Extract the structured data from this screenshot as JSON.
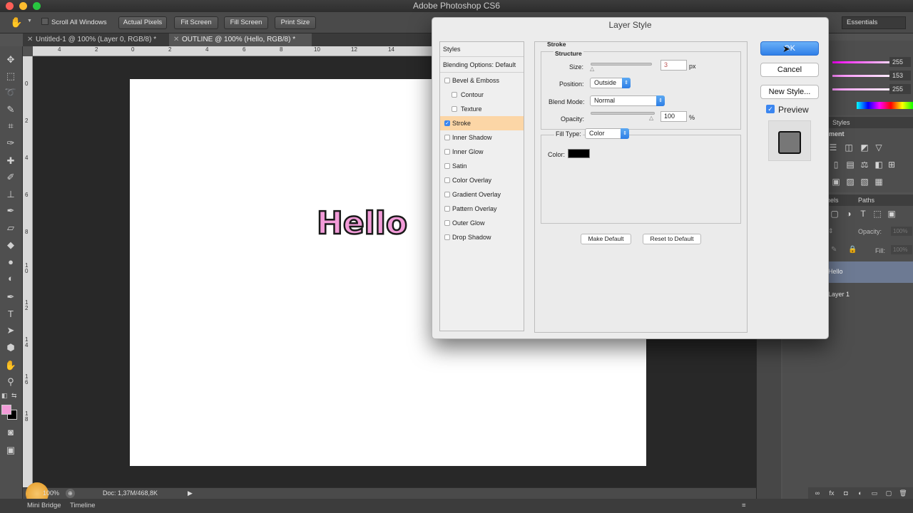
{
  "app": {
    "title": "Adobe Photoshop CS6"
  },
  "options_bar": {
    "scroll_all_windows": "Scroll All Windows",
    "actual_pixels": "Actual Pixels",
    "fit_screen": "Fit Screen",
    "fill_screen": "Fill Screen",
    "print_size": "Print Size",
    "workspace": "Essentials"
  },
  "tabs": [
    {
      "label": "Untitled-1 @ 100% (Layer 0, RGB/8) *"
    },
    {
      "label": "OUTLINE @ 100% (Hello, RGB/8) *"
    }
  ],
  "ruler": {
    "h_ticks": [
      "4",
      "2",
      "0",
      "2",
      "4",
      "6",
      "8",
      "10",
      "12",
      "14"
    ],
    "v_ticks": [
      "0",
      "2",
      "4",
      "6",
      "8",
      "1 0",
      "1 2",
      "1 4",
      "1 6",
      "1 8"
    ]
  },
  "canvas": {
    "text": "Hello",
    "text_fill": "#f29bd8",
    "stroke_color": "#1a1a1a"
  },
  "status": {
    "zoom": "100%",
    "doc_info": "Doc: 1,37M/468,8K"
  },
  "bottom_tabs": {
    "mini_bridge": "Mini Bridge",
    "timeline": "Timeline"
  },
  "color_panel": {
    "r": "255",
    "g": "153",
    "b": "255"
  },
  "styles_panel": {
    "tab": "Styles",
    "section": "ment"
  },
  "layers_panel": {
    "tab_channels": "nels",
    "tab_paths": "Paths",
    "opacity_label": "Opacity:",
    "opacity_value": "100%",
    "fill_label": "Fill:",
    "fill_value": "100%",
    "layers": [
      {
        "name": "Hello"
      },
      {
        "name": "Layer 1"
      }
    ]
  },
  "dialog": {
    "title": "Layer Style",
    "styles_header": "Styles",
    "blending_options": "Blending Options: Default",
    "style_items": [
      {
        "label": "Bevel & Emboss",
        "checked": false,
        "indent": false
      },
      {
        "label": "Contour",
        "checked": false,
        "indent": true
      },
      {
        "label": "Texture",
        "checked": false,
        "indent": true
      },
      {
        "label": "Stroke",
        "checked": true,
        "indent": false
      },
      {
        "label": "Inner Shadow",
        "checked": false,
        "indent": false
      },
      {
        "label": "Inner Glow",
        "checked": false,
        "indent": false
      },
      {
        "label": "Satin",
        "checked": false,
        "indent": false
      },
      {
        "label": "Color Overlay",
        "checked": false,
        "indent": false
      },
      {
        "label": "Gradient Overlay",
        "checked": false,
        "indent": false
      },
      {
        "label": "Pattern Overlay",
        "checked": false,
        "indent": false
      },
      {
        "label": "Outer Glow",
        "checked": false,
        "indent": false
      },
      {
        "label": "Drop Shadow",
        "checked": false,
        "indent": false
      }
    ],
    "stroke": {
      "section_title": "Stroke",
      "structure_title": "Structure",
      "size_label": "Size:",
      "size_value": "3",
      "size_unit": "px",
      "position_label": "Position:",
      "position_value": "Outside",
      "blend_label": "Blend Mode:",
      "blend_value": "Normal",
      "opacity_label": "Opacity:",
      "opacity_value": "100",
      "opacity_unit": "%",
      "fill_type_label": "Fill Type:",
      "fill_type_value": "Color",
      "color_label": "Color:",
      "color_value": "#000000",
      "make_default": "Make Default",
      "reset_default": "Reset to Default"
    },
    "buttons": {
      "ok": "OK",
      "cancel": "Cancel",
      "new_style": "New Style...",
      "preview": "Preview"
    },
    "preview_checked": true
  },
  "colors": {
    "accent": "#3b86f0",
    "stroke_selected_bg": "#fcd6a6",
    "foreground": "#f29bd8",
    "background": "#000000"
  }
}
